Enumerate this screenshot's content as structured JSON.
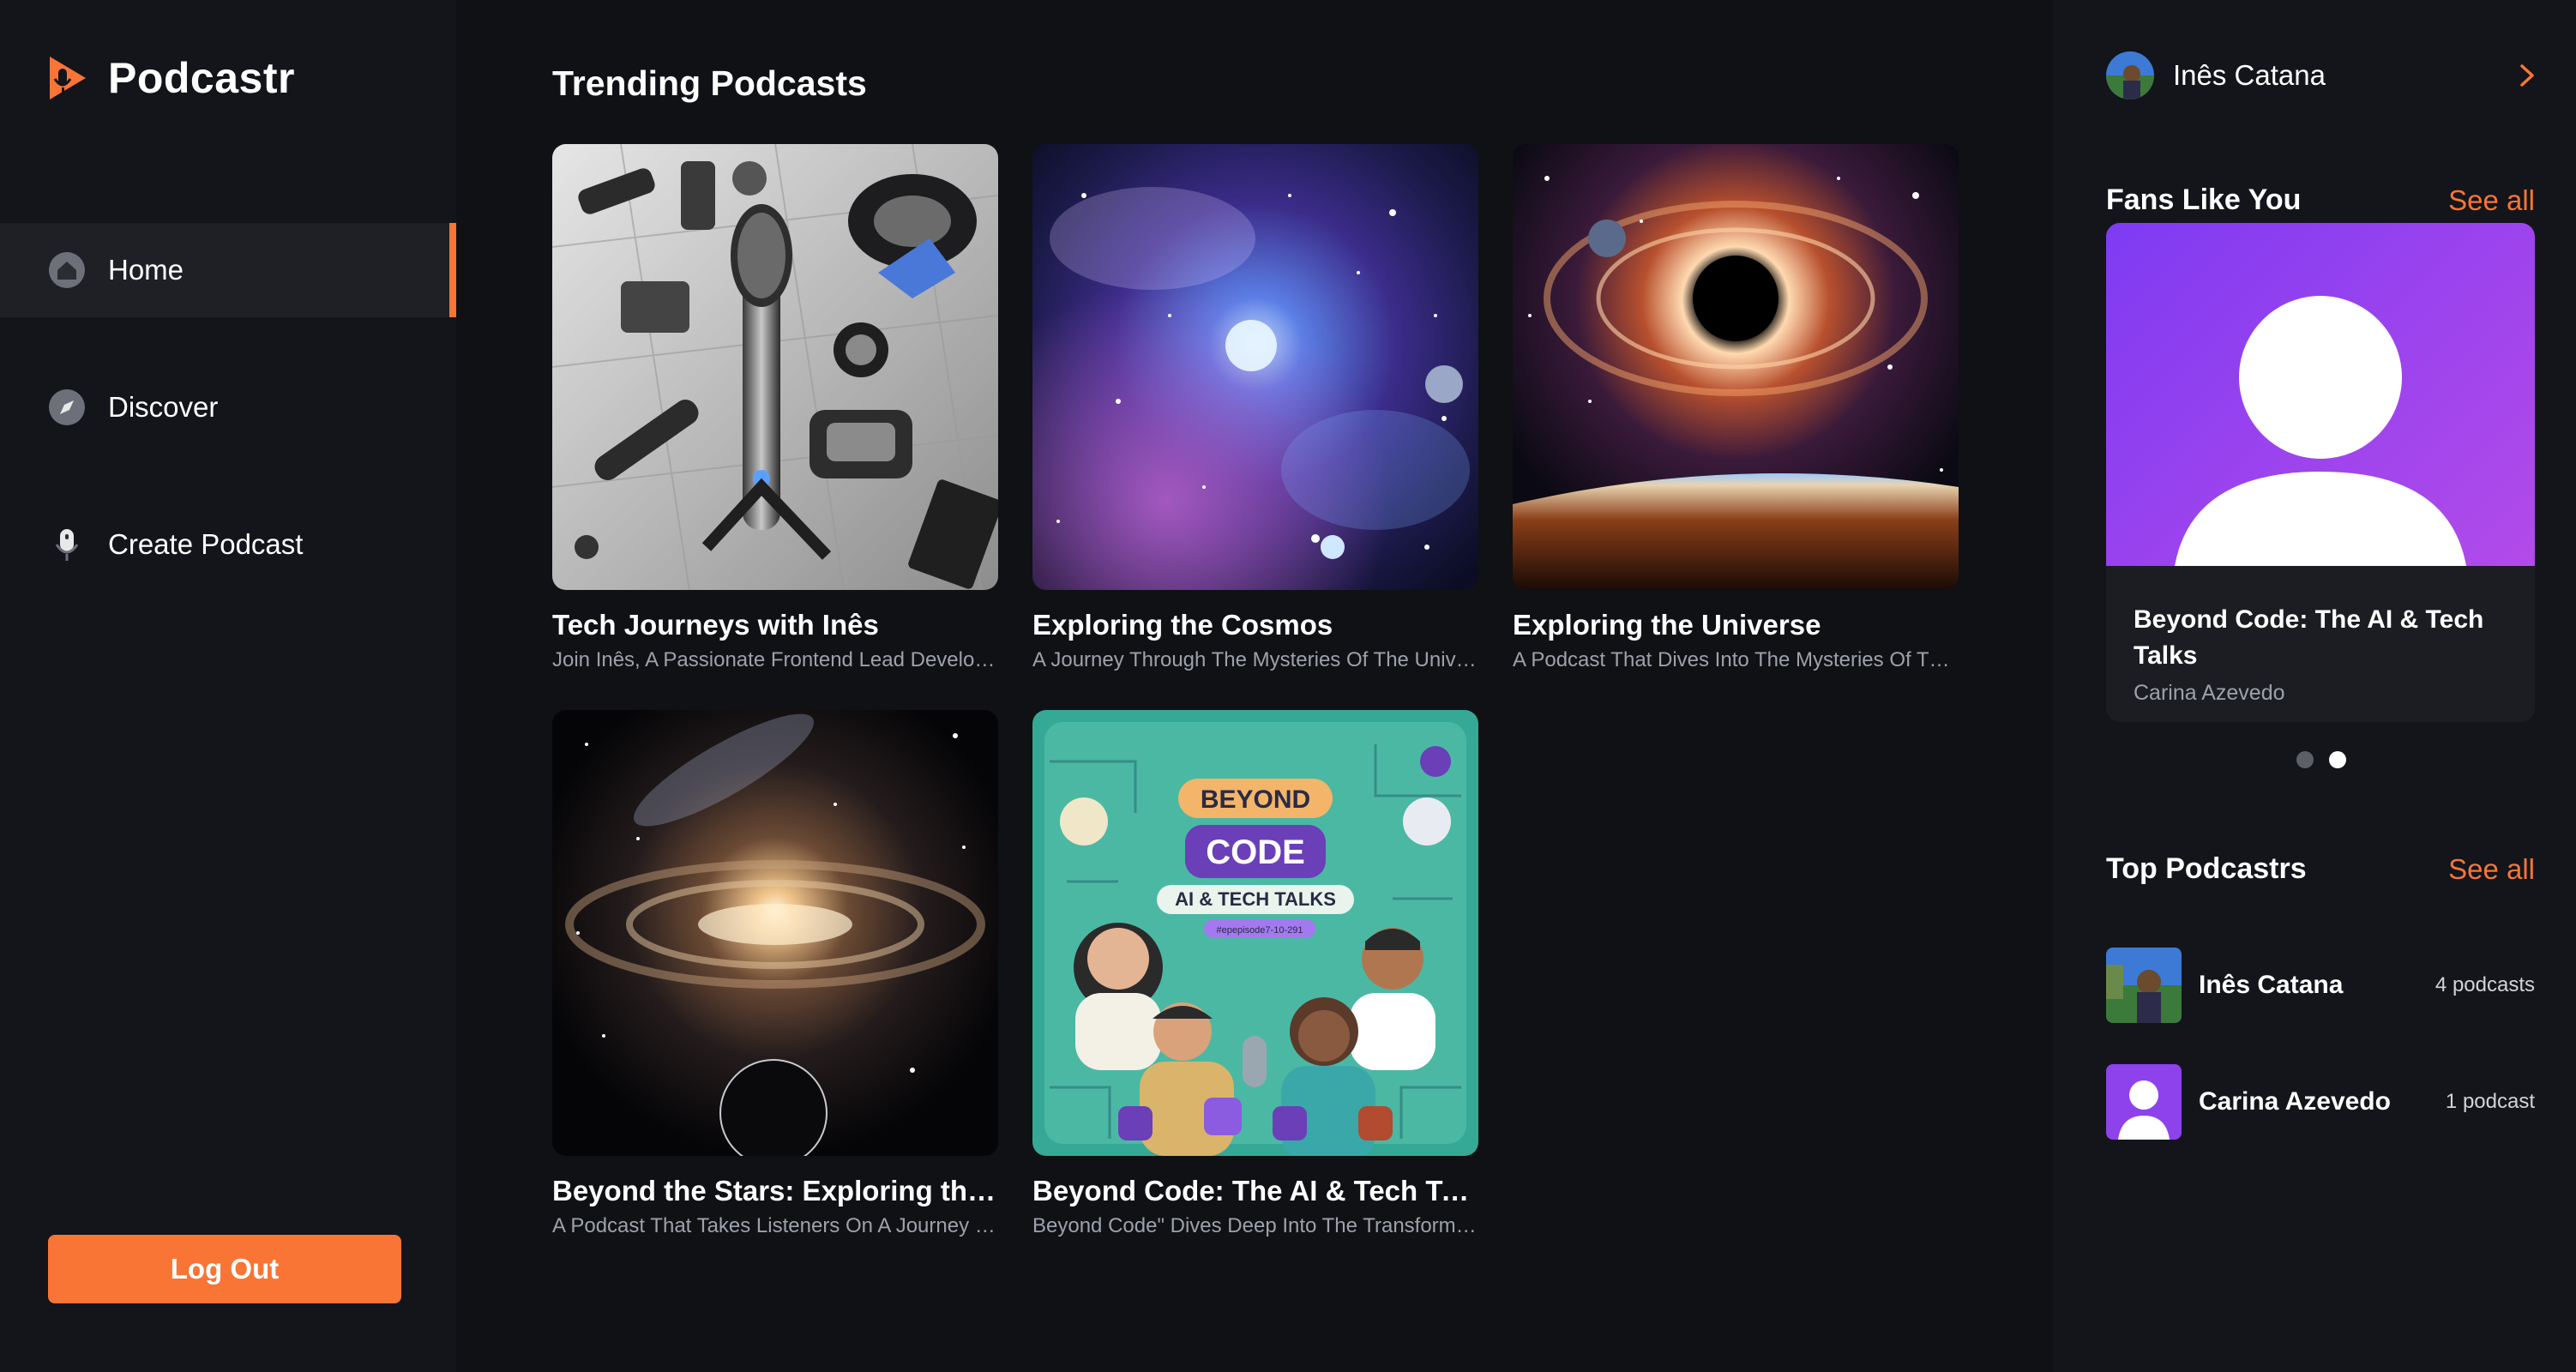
{
  "app": {
    "name": "Podcastr"
  },
  "nav": {
    "items": [
      {
        "label": "Home",
        "icon": "home-icon",
        "active": true
      },
      {
        "label": "Discover",
        "icon": "compass-icon",
        "active": false
      },
      {
        "label": "Create Podcast",
        "icon": "microphone-icon",
        "active": false
      }
    ],
    "logout_label": "Log Out"
  },
  "main": {
    "section_title": "Trending Podcasts",
    "podcasts": [
      {
        "title": "Tech Journeys with Inês",
        "description": "Join Inês, A Passionate Frontend Lead Developer",
        "image": "tech-gadgets"
      },
      {
        "title": "Exploring the Cosmos",
        "description": "A Journey Through The Mysteries Of The Universe",
        "image": "nebula"
      },
      {
        "title": "Exploring the Universe",
        "description": "A Podcast That Dives Into The Mysteries Of The Universe",
        "image": "black-hole"
      },
      {
        "title": "Beyond the Stars: Exploring the Universe",
        "description": "A Podcast That Takes Listeners On A Journey Beyond",
        "image": "galaxy"
      },
      {
        "title": "Beyond Code: The AI & Tech Talks",
        "description": "Beyond Code\" Dives Deep Into The Transformative",
        "image": "beyond-code-cover"
      }
    ],
    "cover_text": {
      "beyond": "BEYOND",
      "code": "CODE",
      "subtitle": "AI & TECH TALKS",
      "tag": "#epepisode7-10-291"
    }
  },
  "right": {
    "user": {
      "name": "Inês Catana"
    },
    "fans": {
      "heading": "Fans Like You",
      "see_all": "See all",
      "card": {
        "title": "Beyond Code: The AI & Tech Talks",
        "author": "Carina Azevedo"
      },
      "dots": [
        false,
        true
      ]
    },
    "top": {
      "heading": "Top Podcastrs",
      "see_all": "See all",
      "items": [
        {
          "name": "Inês Catana",
          "count": "4 podcasts"
        },
        {
          "name": "Carina Azevedo",
          "count": "1 podcast"
        }
      ]
    }
  },
  "colors": {
    "accent": "#f97535",
    "background": "#101114",
    "sidebar": "#13151b",
    "muted_text": "#9ea1ab",
    "fan_card_gradient": [
      "#7e3bf2",
      "#b24be9"
    ]
  }
}
